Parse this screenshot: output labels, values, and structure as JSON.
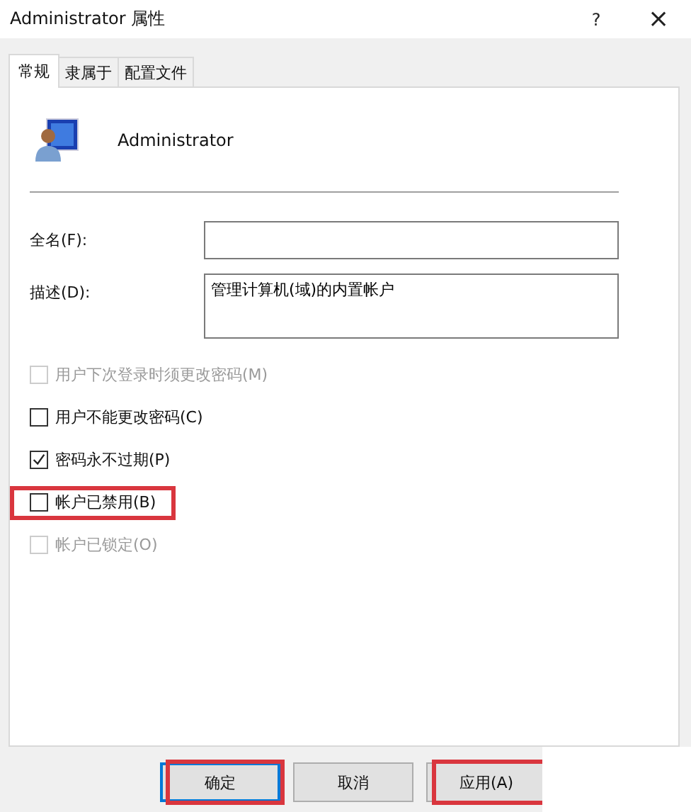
{
  "window": {
    "title": "Administrator 属性",
    "help": "?",
    "close": "×"
  },
  "tabs": [
    {
      "label": "常规",
      "selected": true
    },
    {
      "label": "隶属于",
      "selected": false
    },
    {
      "label": "配置文件",
      "selected": false
    }
  ],
  "user": {
    "name": "Administrator"
  },
  "fields": [
    {
      "label": "全名(F):",
      "multiline": false
    },
    {
      "label": "描述(D):",
      "value": "管理计算机(域)的内置帐户",
      "multiline": true
    }
  ],
  "options": [
    {
      "label": "用户下次登录时须更改密码(M)",
      "checked": false,
      "disabled": true,
      "highlighted": false
    },
    {
      "label": "用户不能更改密码(C)",
      "checked": false,
      "disabled": false,
      "highlighted": false
    },
    {
      "label": "密码永不过期(P)",
      "checked": true,
      "disabled": false,
      "highlighted": false
    },
    {
      "label": "帐户已禁用(B)",
      "checked": false,
      "disabled": false,
      "highlighted": true
    },
    {
      "label": "帐户已锁定(O)",
      "checked": false,
      "disabled": true,
      "highlighted": false
    }
  ],
  "buttons": [
    {
      "label": "确定",
      "default": true,
      "highlighted": true
    },
    {
      "label": "取消",
      "default": false,
      "highlighted": false
    },
    {
      "label": "应用(A)",
      "default": false,
      "highlighted": true
    }
  ]
}
